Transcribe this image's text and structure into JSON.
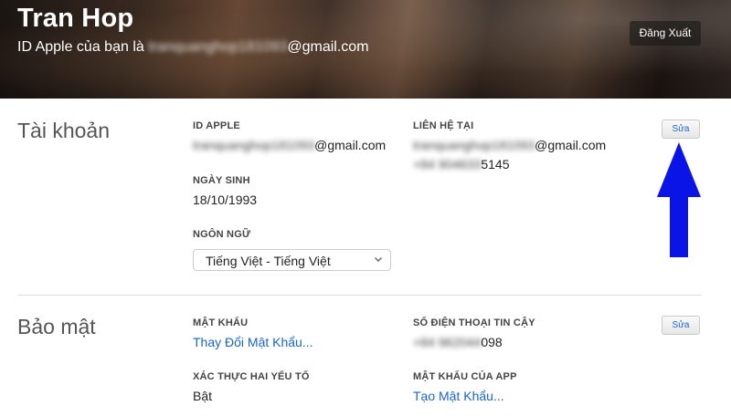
{
  "header": {
    "user_name": "Tran Hop",
    "apple_id_prefix": "ID Apple của bạn là",
    "apple_id_hidden": "tranquanghop181093",
    "apple_id_suffix": "@gmail.com",
    "signout_label": "Đăng Xuất"
  },
  "account": {
    "title": "Tài khoản",
    "apple_id_label": "ID APPLE",
    "apple_id_hidden": "tranquanghop181093",
    "apple_id_suffix": "@gmail.com",
    "birthday_label": "NGÀY SINH",
    "birthday_value": "18/10/1993",
    "language_label": "NGÔN NGỮ",
    "language_selected": "Tiếng Việt - Tiếng Việt",
    "contact_label": "LIÊN HỆ TẠI",
    "contact_email_hidden": "tranquanghop181093",
    "contact_email_suffix": "@gmail.com",
    "contact_phone_hidden": "+84 904633",
    "contact_phone_suffix": "5145",
    "edit_label": "Sửa"
  },
  "security": {
    "title": "Bảo mật",
    "password_label": "MẬT KHẨU",
    "password_link": "Thay Đổi Mật Khẩu...",
    "trusted_phone_label": "SỐ ĐIỆN THOẠI TIN CẬY",
    "trusted_phone_hidden": "+84 962044",
    "trusted_phone_suffix": "098",
    "two_factor_label": "XÁC THỰC HAI YẾU TỐ",
    "two_factor_value": "Bật",
    "app_password_label": "MẬT KHẨU CỦA APP",
    "app_password_link": "Tạo Mật Khẩu...",
    "edit_label": "Sửa"
  },
  "colors": {
    "link": "#1a66c4",
    "annotation_arrow": "#0a14e6"
  },
  "icons": {
    "select_chevron": "chevron-down-icon",
    "annotation": "arrow-up-icon"
  }
}
